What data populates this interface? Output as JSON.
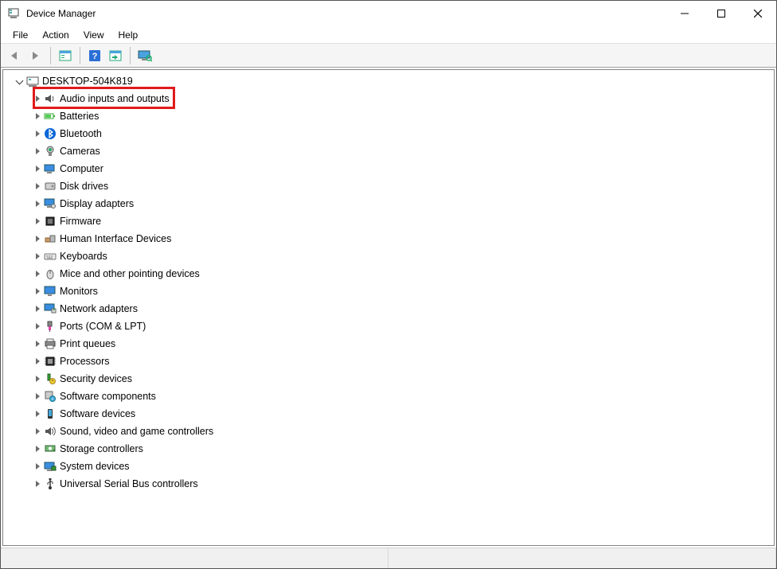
{
  "window": {
    "title": "Device Manager"
  },
  "menu": {
    "file": "File",
    "action": "Action",
    "view": "View",
    "help": "Help"
  },
  "tree": {
    "root": "DESKTOP-504K819",
    "categories": [
      {
        "label": "Audio inputs and outputs",
        "icon": "speaker-icon",
        "hl": true
      },
      {
        "label": "Batteries",
        "icon": "battery-icon"
      },
      {
        "label": "Bluetooth",
        "icon": "bluetooth-icon"
      },
      {
        "label": "Cameras",
        "icon": "camera-icon"
      },
      {
        "label": "Computer",
        "icon": "computer-icon"
      },
      {
        "label": "Disk drives",
        "icon": "disk-icon"
      },
      {
        "label": "Display adapters",
        "icon": "display-icon"
      },
      {
        "label": "Firmware",
        "icon": "firmware-icon"
      },
      {
        "label": "Human Interface Devices",
        "icon": "hid-icon"
      },
      {
        "label": "Keyboards",
        "icon": "keyboard-icon"
      },
      {
        "label": "Mice and other pointing devices",
        "icon": "mouse-icon"
      },
      {
        "label": "Monitors",
        "icon": "monitor-icon"
      },
      {
        "label": "Network adapters",
        "icon": "network-icon"
      },
      {
        "label": "Ports (COM & LPT)",
        "icon": "ports-icon"
      },
      {
        "label": "Print queues",
        "icon": "printer-icon"
      },
      {
        "label": "Processors",
        "icon": "cpu-icon"
      },
      {
        "label": "Security devices",
        "icon": "security-icon"
      },
      {
        "label": "Software components",
        "icon": "software-component-icon"
      },
      {
        "label": "Software devices",
        "icon": "software-device-icon"
      },
      {
        "label": "Sound, video and game controllers",
        "icon": "sound-icon"
      },
      {
        "label": "Storage controllers",
        "icon": "storage-icon"
      },
      {
        "label": "System devices",
        "icon": "system-icon"
      },
      {
        "label": "Universal Serial Bus controllers",
        "icon": "usb-icon"
      }
    ]
  }
}
